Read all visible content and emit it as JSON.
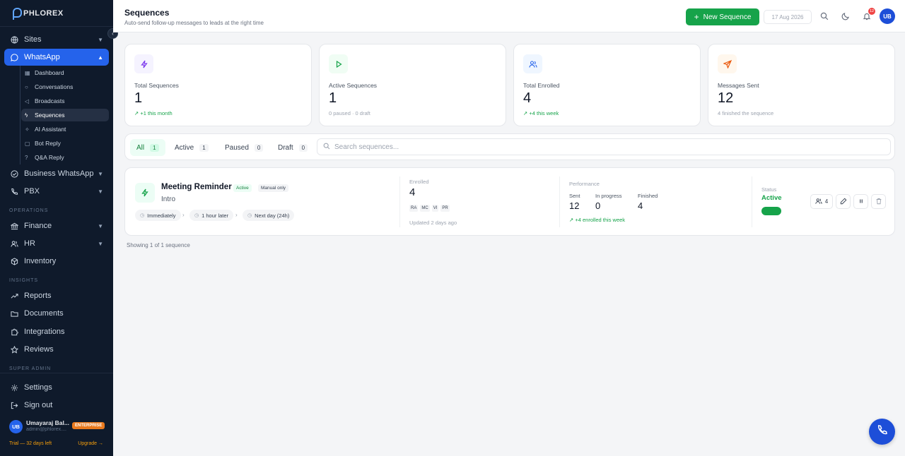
{
  "brand": {
    "name": "PHLOREX"
  },
  "sidebar": {
    "items": [
      {
        "label": "Sites",
        "icon": "globe-icon"
      },
      {
        "label": "WhatsApp",
        "icon": "chat-icon"
      },
      {
        "label": "Business WhatsApp",
        "icon": "check-circle-icon"
      },
      {
        "label": "PBX",
        "icon": "phone-icon"
      },
      {
        "label": "Finance",
        "icon": "bank-icon"
      },
      {
        "label": "HR",
        "icon": "users-icon"
      },
      {
        "label": "Inventory",
        "icon": "box-icon"
      },
      {
        "label": "Reports",
        "icon": "trend-icon"
      },
      {
        "label": "Documents",
        "icon": "folder-icon"
      },
      {
        "label": "Integrations",
        "icon": "puzzle-icon"
      },
      {
        "label": "Reviews",
        "icon": "star-icon"
      },
      {
        "label": "Settings",
        "icon": "gear-icon"
      },
      {
        "label": "Sign out",
        "icon": "logout-icon"
      }
    ],
    "whatsapp_sub": [
      {
        "label": "Dashboard"
      },
      {
        "label": "Conversations"
      },
      {
        "label": "Broadcasts"
      },
      {
        "label": "Sequences"
      },
      {
        "label": "AI Assistant"
      },
      {
        "label": "Bot Reply"
      },
      {
        "label": "Q&A Reply"
      }
    ],
    "sections": {
      "operations": "OPERATIONS",
      "insights": "INSIGHTS",
      "super_admin": "SUPER ADMIN"
    },
    "user": {
      "initials": "UB",
      "name": "Umayaraj Bal...",
      "email": "admin@phlorex....",
      "plan": "ENTERPRISE",
      "trial": "Trial — 32 days left",
      "upgrade": "Upgrade →"
    }
  },
  "header": {
    "title": "Sequences",
    "subtitle": "Auto-send follow-up messages to leads at the right time",
    "new_button": "New Sequence",
    "date": "17 Aug 2026",
    "notifications": "12",
    "avatar": "UB"
  },
  "stats": [
    {
      "label": "Total Sequences",
      "value": "1",
      "foot": "+1 this month",
      "color": "#7c3aed",
      "bg": "#f5f3ff"
    },
    {
      "label": "Active Sequences",
      "value": "1",
      "foot": "0 paused · 0 draft",
      "color": "#16a34a",
      "bg": "#f0fdf4"
    },
    {
      "label": "Total Enrolled",
      "value": "4",
      "foot": "+4 this week",
      "color": "#2563eb",
      "bg": "#eff6ff"
    },
    {
      "label": "Messages Sent",
      "value": "12",
      "foot": "4 finished the sequence",
      "color": "#ea580c",
      "bg": "#fff7ed"
    }
  ],
  "filters": {
    "tabs": [
      {
        "label": "All",
        "count": "1"
      },
      {
        "label": "Active",
        "count": "1"
      },
      {
        "label": "Paused",
        "count": "0"
      },
      {
        "label": "Draft",
        "count": "0"
      }
    ],
    "search_placeholder": "Search sequences..."
  },
  "sequence": {
    "name": "Meeting Reminder",
    "badge_status": "Active",
    "badge_type": "Manual only",
    "subtitle": "Intro",
    "steps": [
      "Immediately",
      "1 hour later",
      "Next day (24h)"
    ],
    "enrolled_label": "Enrolled",
    "enrolled": "4",
    "initials": [
      "RA",
      "MC",
      "VI",
      "PR"
    ],
    "updated": "Updated 2 days ago",
    "performance_label": "Performance",
    "sent_label": "Sent",
    "sent": "12",
    "in_progress_label": "In progress",
    "in_progress": "0",
    "finished_label": "Finished",
    "finished": "4",
    "performance_foot": "+4 enrolled this week",
    "status_label": "Status",
    "status": "Active",
    "enrolled_btn": "4"
  },
  "footer": {
    "showing": "Showing 1 of 1 sequence"
  }
}
